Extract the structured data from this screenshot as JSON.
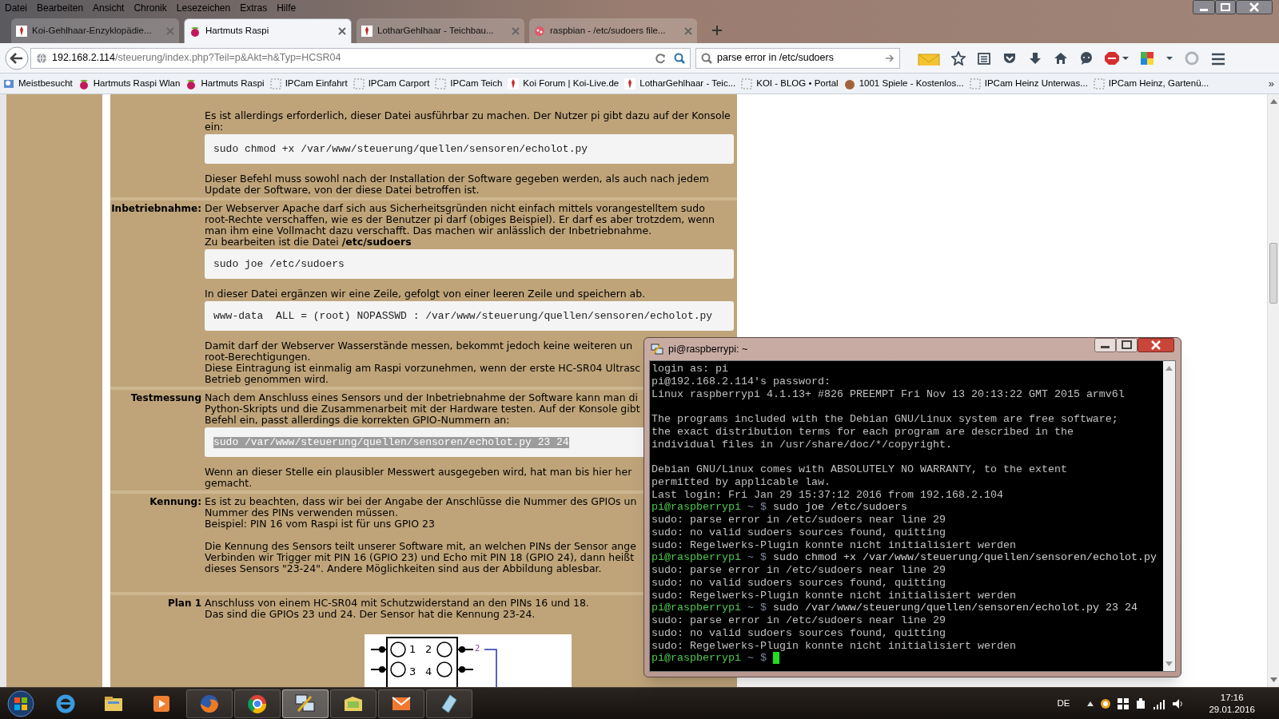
{
  "menu_bar": [
    "Datei",
    "Bearbeiten",
    "Ansicht",
    "Chronik",
    "Lesezeichen",
    "Extras",
    "Hilfe"
  ],
  "tabs": [
    {
      "title": "Koi-Gehlhaar-Enzyklopädie...",
      "selected": false
    },
    {
      "title": "Hartmuts Raspi",
      "selected": true
    },
    {
      "title": "LotharGehlhaar - Teichbau...",
      "selected": false
    },
    {
      "title": "raspbian - /etc/sudoers file...",
      "selected": false
    }
  ],
  "address_bar": {
    "host": "192.168.2.114",
    "path": "/steuerung/index.php?Teil=p&Akt=h&Typ=HCSR04"
  },
  "search_field": {
    "value": "parse error in /etc/sudoers"
  },
  "bookmarks": [
    "Meistbesucht",
    "Hartmuts Raspi Wlan",
    "Hartmuts Raspi",
    "IPCam Einfahrt",
    "IPCam Carport",
    "IPCam Teich",
    "Koi Forum | Koi-Live.de",
    "LotharGehlhaar - Teic...",
    "KOI - BLOG • Portal",
    "1001 Spiele - Kostenlos...",
    "IPCam Heinz Unterwas...",
    "IPCam Heinz, Gartenü..."
  ],
  "bookmarks_overflow": "»",
  "sections": [
    {
      "blocks": [
        {
          "kind": "text",
          "lines": [
            "Es ist allerdings erforderlich, dieser Datei ausführbar zu machen. Der Nutzer pi gibt dazu auf der Konsole",
            "ein:"
          ]
        },
        {
          "kind": "code",
          "text": "sudo chmod +x /var/www/steuerung/quellen/sensoren/echolot.py",
          "selected": false
        },
        {
          "kind": "text",
          "lines": [
            "Dieser Befehl muss sowohl nach der Installation der Software gegeben werden, als auch nach jedem",
            "Update der Software, von der diese Datei betroffen ist."
          ]
        }
      ]
    },
    {
      "label": "Inbetriebnahme:",
      "blocks": [
        {
          "kind": "text",
          "lines": [
            "Der Webserver Apache darf sich aus Sicherheitsgründen nicht einfach mittels vorangestelltem sudo",
            "root-Rechte verschaffen, wie es der Benutzer pi darf (obiges Beispiel). Er darf es aber trotzdem, wenn",
            "man ihm eine Vollmacht dazu verschafft. Das machen wir anlässlich der Inbetriebnahme.",
            "Zu bearbeiten ist die Datei **/etc/sudoers**"
          ]
        },
        {
          "kind": "code",
          "text": "sudo joe /etc/sudoers",
          "selected": false
        },
        {
          "kind": "text",
          "lines": [
            "In dieser Datei ergänzen wir eine Zeile, gefolgt von einer leeren Zeile und speichern ab."
          ]
        },
        {
          "kind": "code",
          "text": "www-data  ALL = (root) NOPASSWD : /var/www/steuerung/quellen/sensoren/echolot.py",
          "selected": false
        },
        {
          "kind": "text",
          "lines": [
            "Damit darf der Webserver Wasserstände messen, bekommt jedoch keine weiteren un",
            "root-Berechtigungen.",
            "Diese Eintragung ist einmalig am Raspi vorzunehmen, wenn der erste HC-SR04 Ultrasc",
            "Betrieb genommen wird."
          ]
        }
      ]
    },
    {
      "label": "Testmessung",
      "blocks": [
        {
          "kind": "text",
          "lines": [
            "Nach dem Anschluss eines Sensors und der Inbetriebnahme der Software kann man di",
            "Python-Skripts und die Zusammenarbeit mit der Hardware testen. Auf der Konsole gibt",
            "Befehl ein, passt allerdings die korrekten GPIO-Nummern an:"
          ]
        },
        {
          "kind": "code",
          "text": "sudo /var/www/steuerung/quellen/sensoren/echolot.py 23 24",
          "selected": true
        },
        {
          "kind": "text",
          "lines": [
            "Wenn an dieser Stelle ein plausibler Messwert ausgegeben wird, hat man bis hier her",
            "gemacht."
          ]
        }
      ]
    },
    {
      "label": "Kennung:",
      "blocks": [
        {
          "kind": "text",
          "lines": [
            "Es ist zu beachten, dass wir bei der Angabe der Anschlüsse die Nummer des GPIOs un",
            "Nummer des PINs verwenden müssen.",
            "Beispiel: PIN 16 vom Raspi ist für uns GPIO 23"
          ]
        },
        {
          "kind": "text",
          "lines": [
            "Die Kennung des Sensors teilt unserer Software mit, an welchen PINs der Sensor ange",
            "Verbinden wir Trigger mit PIN 16 (GPIO 23) und Echo mit PIN 18 (GPIO 24), dann heißt",
            "dieses Sensors \"23-24\". Andere Möglichkeiten sind aus der Abbildung ablesbar."
          ]
        }
      ]
    },
    {
      "label": "Plan 1",
      "blocks": [
        {
          "kind": "text",
          "lines": [
            "Anschluss von einem HC-SR04 mit Schutzwiderstand an den PINs 16 und 18.",
            "Das sind die GPIOs 23 und 24. Der Sensor hat die Kennung 23-24."
          ]
        },
        {
          "kind": "diagram",
          "pins": [
            "1",
            "2",
            "3",
            "4"
          ],
          "wire_label": "2"
        }
      ]
    }
  ],
  "terminal": {
    "title": "pi@raspberrypi: ~",
    "cursor": true,
    "lines": [
      {
        "kind": "output",
        "text": "login as: pi"
      },
      {
        "kind": "output",
        "text": "pi@192.168.2.114's password:"
      },
      {
        "kind": "output",
        "text": "Linux raspberrypi 4.1.13+ #826 PREEMPT Fri Nov 13 20:13:22 GMT 2015 armv6l"
      },
      {
        "kind": "blank"
      },
      {
        "kind": "output",
        "text": "The programs included with the Debian GNU/Linux system are free software;"
      },
      {
        "kind": "output",
        "text": "the exact distribution terms for each program are described in the"
      },
      {
        "kind": "output",
        "text": "individual files in /usr/share/doc/*/copyright."
      },
      {
        "kind": "blank"
      },
      {
        "kind": "output",
        "text": "Debian GNU/Linux comes with ABSOLUTELY NO WARRANTY, to the extent"
      },
      {
        "kind": "output",
        "text": "permitted by applicable law."
      },
      {
        "kind": "output",
        "text": "Last login: Fri Jan 29 15:37:12 2016 from 192.168.2.104"
      },
      {
        "kind": "prompt",
        "user": "pi@raspberrypi",
        "path": "~ $",
        "command": "sudo joe /etc/sudoers"
      },
      {
        "kind": "output",
        "text": "sudo: parse error in /etc/sudoers near line 29"
      },
      {
        "kind": "output",
        "text": "sudo: no valid sudoers sources found, quitting"
      },
      {
        "kind": "output",
        "text": "sudo: Regelwerks-Plugin konnte nicht initialisiert werden"
      },
      {
        "kind": "prompt",
        "user": "pi@raspberrypi",
        "path": "~ $",
        "command": "sudo chmod +x /var/www/steuerung/quellen/sensoren/echolot.py"
      },
      {
        "kind": "output",
        "text": "sudo: parse error in /etc/sudoers near line 29"
      },
      {
        "kind": "output",
        "text": "sudo: no valid sudoers sources found, quitting"
      },
      {
        "kind": "output",
        "text": "sudo: Regelwerks-Plugin konnte nicht initialisiert werden"
      },
      {
        "kind": "prompt",
        "user": "pi@raspberrypi",
        "path": "~ $",
        "command": "sudo /var/www/steuerung/quellen/sensoren/echolot.py 23 24"
      },
      {
        "kind": "output",
        "text": "sudo: parse error in /etc/sudoers near line 29"
      },
      {
        "kind": "output",
        "text": "sudo: no valid sudoers sources found, quitting"
      },
      {
        "kind": "output",
        "text": "sudo: Regelwerks-Plugin konnte nicht initialisiert werden"
      },
      {
        "kind": "prompt",
        "user": "pi@raspberrypi",
        "path": "~ $"
      }
    ]
  },
  "taskbar": {
    "apps": [
      {
        "selected": false
      },
      {
        "selected": false
      },
      {
        "selected": false
      },
      {
        "selected": false
      },
      {
        "selected": false
      },
      {
        "selected": true
      },
      {
        "selected": false
      },
      {
        "selected": false
      },
      {
        "selected": false
      }
    ],
    "language": "DE",
    "time": "17:16",
    "date": "29.01.2016"
  }
}
